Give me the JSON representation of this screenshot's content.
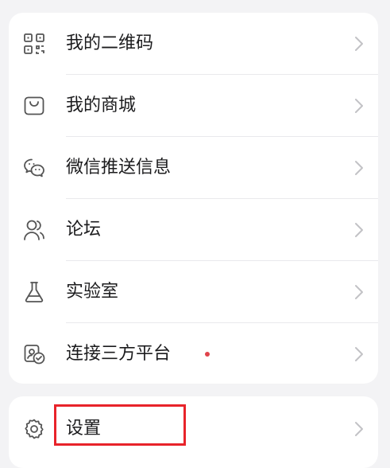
{
  "menu": {
    "items": [
      {
        "label": "我的二维码",
        "icon": "qr-code-icon"
      },
      {
        "label": "我的商城",
        "icon": "shopping-bag-icon"
      },
      {
        "label": "微信推送信息",
        "icon": "wechat-icon"
      },
      {
        "label": "论坛",
        "icon": "user-forum-icon"
      },
      {
        "label": "实验室",
        "icon": "flask-icon"
      },
      {
        "label": "连接三方平台",
        "icon": "third-party-link-icon",
        "badge_dot": true
      }
    ]
  },
  "settings": {
    "label": "设置",
    "icon": "gear-icon",
    "highlighted": true
  },
  "colors": {
    "page_background": "#f3f3f5",
    "card_background": "#ffffff",
    "text": "#1c1c1e",
    "icon_stroke": "#555555",
    "chevron": "#c2c2c6",
    "badge_dot": "#e0434b",
    "highlight_border": "#e8232a"
  }
}
